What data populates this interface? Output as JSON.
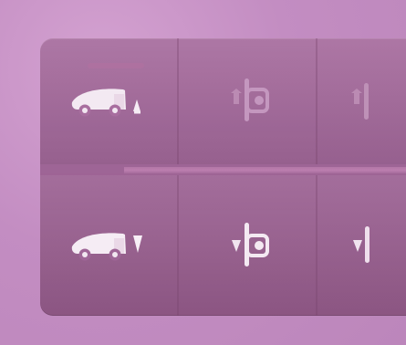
{
  "panel": {
    "rows": [
      {
        "name": "top-row",
        "controls": [
          {
            "icon": "truck-raise-icon",
            "state": "selected"
          },
          {
            "icon": "height-adjust-icon",
            "state": "dimmed"
          },
          {
            "icon": "partial-icon",
            "state": "dimmed"
          }
        ]
      },
      {
        "name": "bottom-row",
        "controls": [
          {
            "icon": "truck-lower-icon",
            "state": "normal"
          },
          {
            "icon": "height-lower-icon",
            "state": "normal"
          },
          {
            "icon": "partial-lower-icon",
            "state": "normal"
          }
        ]
      }
    ]
  },
  "colors": {
    "background": "#c591c4",
    "panel": "#a86e9f",
    "icon_light": "#f6eaf2",
    "icon_dim": "#b985ae"
  }
}
